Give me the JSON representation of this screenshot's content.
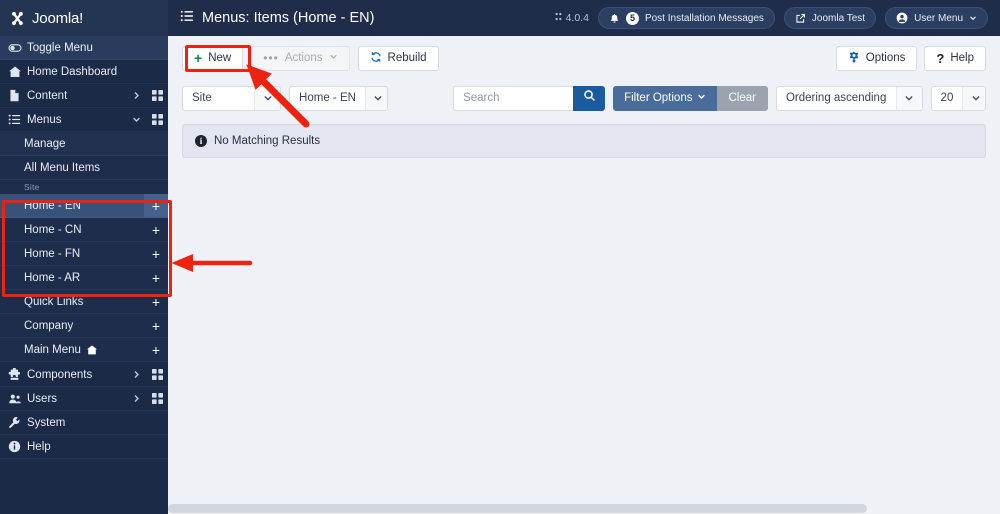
{
  "brand": {
    "name": "Joomla!",
    "logo_icon": "joomla-logo-icon"
  },
  "header": {
    "menu_icon": "list-icon",
    "title": "Menus: Items (Home - EN)",
    "version": "4.0.4",
    "version_icon": "joomla-small-icon",
    "messages": {
      "icon": "bell-icon",
      "count": "5",
      "label": "Post Installation Messages"
    },
    "site_link": {
      "icon": "external-link-icon",
      "label": "Joomla Test"
    },
    "user_menu": {
      "icon": "user-circle-icon",
      "label": "User Menu",
      "caret": "chevron-down-icon"
    }
  },
  "sidebar": {
    "items": [
      {
        "label": "Toggle Menu",
        "icon": "toggle-icon",
        "caret": "",
        "grid": false,
        "active": true
      },
      {
        "label": "Home Dashboard",
        "icon": "home-icon",
        "caret": "",
        "grid": false,
        "active": false
      },
      {
        "label": "Content",
        "icon": "document-icon",
        "caret": "chevron-right-icon",
        "grid": true,
        "active": false
      },
      {
        "label": "Menus",
        "icon": "list-icon",
        "caret": "chevron-down-icon",
        "grid": true,
        "active": false
      }
    ],
    "menus_submenu": [
      {
        "label": "Manage",
        "type": "plain"
      },
      {
        "label": "All Menu Items",
        "type": "plain"
      }
    ],
    "section_label": "Site",
    "menu_list": [
      {
        "label": "Home - EN",
        "plus": "+",
        "active": true,
        "home": false
      },
      {
        "label": "Home - CN",
        "plus": "+",
        "active": false,
        "home": false
      },
      {
        "label": "Home - FN",
        "plus": "+",
        "active": false,
        "home": false
      },
      {
        "label": "Home - AR",
        "plus": "+",
        "active": false,
        "home": false
      },
      {
        "label": "Quick Links",
        "plus": "+",
        "active": false,
        "home": false
      },
      {
        "label": "Company",
        "plus": "+",
        "active": false,
        "home": false
      },
      {
        "label": "Main Menu",
        "plus": "+",
        "active": false,
        "home": true
      }
    ],
    "bottom_items": [
      {
        "label": "Components",
        "icon": "puzzle-icon",
        "caret": "chevron-right-icon",
        "grid": true
      },
      {
        "label": "Users",
        "icon": "users-icon",
        "caret": "chevron-right-icon",
        "grid": true
      },
      {
        "label": "System",
        "icon": "wrench-icon",
        "caret": "",
        "grid": false
      },
      {
        "label": "Help",
        "icon": "info-icon",
        "caret": "",
        "grid": false
      }
    ]
  },
  "toolbar": {
    "new_label": "New",
    "new_icon": "plus-icon",
    "actions_label": "Actions",
    "actions_icon": "ellipsis-icon",
    "actions_caret": "chevron-down-icon",
    "rebuild_label": "Rebuild",
    "rebuild_icon": "refresh-icon",
    "options_label": "Options",
    "options_icon": "gear-icon",
    "help_label": "Help",
    "help_icon": "question-icon"
  },
  "filters": {
    "site_select": "Site",
    "menu_select": "Home - EN",
    "search_placeholder": "Search",
    "search_value": "",
    "search_icon": "search-icon",
    "filter_options_label": "Filter Options",
    "filter_options_caret": "chevron-down-icon",
    "clear_label": "Clear",
    "ordering_select": "Ordering ascending",
    "limit_select": "20"
  },
  "main": {
    "alert_icon": "info-icon",
    "alert_text": "No Matching Results"
  },
  "annotations": {
    "highlight_color": "#ee2211",
    "new_button_box": "highlight-box-new-button",
    "menu_items_box": "highlight-box-menu-items",
    "arrow_to_new": "arrow-pointing-to-new-button",
    "arrow_to_menus": "arrow-pointing-to-menu-items"
  }
}
